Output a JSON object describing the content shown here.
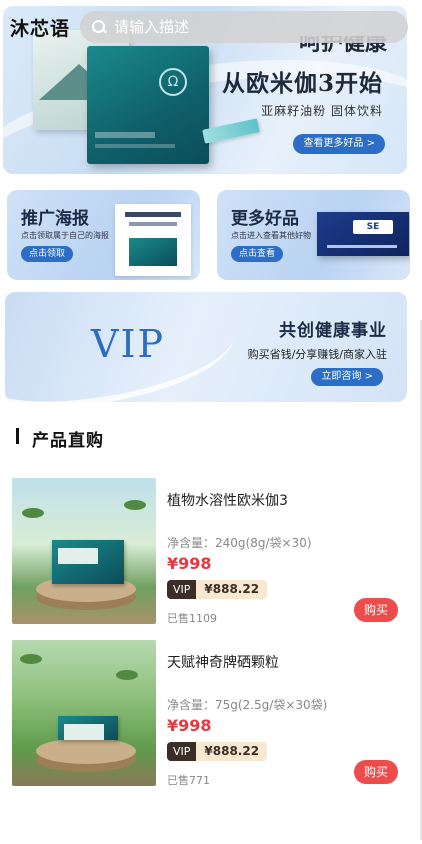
{
  "header": {
    "brand": "沐芯语",
    "search_placeholder": "请输入描述"
  },
  "hero": {
    "title_partial": "呵护健康",
    "title": "从欧米伽3开始",
    "subtitle": "亚麻籽油粉  固体饮料",
    "button": "查看更多好品 >"
  },
  "promo_cards": [
    {
      "title": "推广海报",
      "desc": "点击领取属于自己的海报",
      "button": "点击领取"
    },
    {
      "title": "更多好品",
      "desc": "点击进入查看其他好物",
      "button": "点击查看"
    }
  ],
  "vip_banner": {
    "word": "VIP",
    "title": "共创健康事业",
    "subtitle": "购买省钱/分享赚钱/商家入驻",
    "button": "立即咨询 >"
  },
  "section": {
    "title": "产品直购"
  },
  "products": [
    {
      "name": "植物水溶性欧米伽3",
      "spec": "净含量：240g(8g/袋×30)",
      "price": "¥998",
      "vip_label": "VIP",
      "vip_price": "¥888.22",
      "sold": "已售1109",
      "buy": "购买"
    },
    {
      "name": "天赋神奇牌硒颗粒",
      "spec": "净含量：75g(2.5g/袋×30袋)",
      "price": "¥998",
      "vip_label": "VIP",
      "vip_price": "¥888.22",
      "sold": "已售771",
      "buy": "购买"
    }
  ],
  "colors": {
    "accent_blue": "#2c6dc6",
    "price_red": "#e8383d",
    "buy_red": "#ee4b4b",
    "vip_dark": "#3a2e26",
    "vip_gold": "#f7e8cf"
  }
}
